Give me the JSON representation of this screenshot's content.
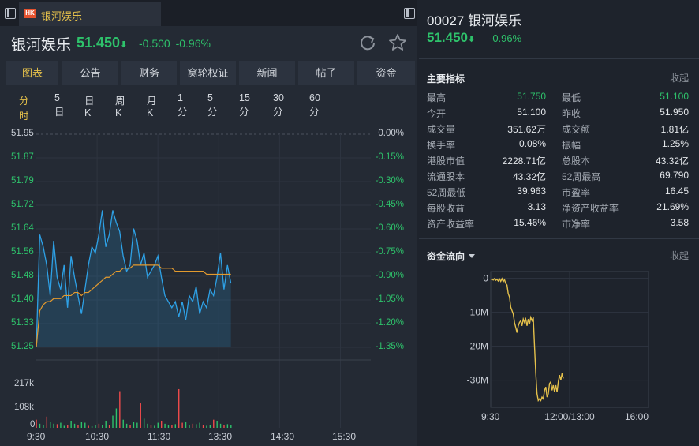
{
  "tab": {
    "badge": "HK",
    "title": "银河娱乐"
  },
  "quote": {
    "name": "银河娱乐",
    "price": "51.450",
    "change": "-0.500",
    "change_pct": "-0.96%"
  },
  "nav": [
    "图表",
    "公告",
    "财务",
    "窝轮权证",
    "新闻",
    "帖子",
    "资金"
  ],
  "periods": [
    "分时",
    "5日",
    "日K",
    "周K",
    "月K",
    "1分",
    "5分",
    "15分",
    "30分",
    "60分"
  ],
  "chart": {
    "price_ticks": [
      "51.95",
      "51.87",
      "51.79",
      "51.72",
      "51.64",
      "51.56",
      "51.48",
      "51.40",
      "51.33",
      "51.25"
    ],
    "pct_ticks": [
      "0.00%",
      "-0.15%",
      "-0.30%",
      "-0.45%",
      "-0.60%",
      "-0.75%",
      "-0.90%",
      "-1.05%",
      "-1.20%",
      "-1.35%"
    ],
    "volume_ticks": [
      "217k",
      "108k",
      "0"
    ],
    "time_ticks": [
      "9:30",
      "10:30",
      "11:30",
      "13:30",
      "14:30",
      "15:30"
    ]
  },
  "chart_data": [
    {
      "type": "line",
      "series": [
        {
          "values": [
            51.25,
            51.62,
            51.58,
            51.52,
            51.42,
            51.6,
            51.48,
            51.44,
            51.52,
            51.38,
            51.55,
            51.48,
            51.42,
            51.36,
            51.44,
            51.52,
            51.58,
            51.56,
            51.62,
            51.7,
            51.58,
            51.62,
            51.7,
            51.66,
            51.63,
            51.55,
            51.5,
            51.52,
            51.64,
            51.6,
            51.52,
            51.56,
            51.48,
            51.5,
            51.52,
            51.55,
            51.48,
            51.42,
            51.4,
            51.38,
            51.4,
            51.35,
            51.4,
            51.34,
            51.42,
            51.4,
            51.45,
            51.36,
            51.4,
            51.38,
            51.44,
            51.42,
            51.48,
            51.56,
            51.44,
            51.52,
            51.46
          ]
        },
        {
          "values": [
            51.25,
            51.37,
            51.39,
            51.4,
            51.4,
            51.41,
            51.41,
            51.41,
            51.42,
            51.42,
            51.42,
            51.43,
            51.43,
            51.42,
            51.43,
            51.43,
            51.44,
            51.45,
            51.46,
            51.47,
            51.48,
            51.48,
            51.49,
            51.5,
            51.5,
            51.51,
            51.51,
            51.51,
            51.52,
            51.52,
            51.52,
            51.52,
            51.52,
            51.52,
            51.52,
            51.52,
            51.51,
            51.51,
            51.51,
            51.51,
            51.5,
            51.5,
            51.5,
            51.5,
            51.5,
            51.5,
            51.5,
            51.5,
            51.5,
            51.49,
            51.49,
            51.49,
            51.49,
            51.49,
            51.49,
            51.49,
            51.49
          ]
        }
      ],
      "ylim": [
        51.25,
        51.95
      ],
      "x_range": [
        "9:30",
        "16:00"
      ]
    },
    {
      "type": "bar",
      "values": [
        40,
        20,
        15,
        55,
        30,
        20,
        18,
        25,
        10,
        15,
        35,
        20,
        12,
        30,
        25,
        10,
        8,
        15,
        20,
        12,
        35,
        15,
        60,
        95,
        180,
        40,
        20,
        15,
        30,
        25,
        120,
        45,
        20,
        15,
        10,
        25,
        35,
        20,
        15,
        12,
        18,
        190,
        25,
        30,
        15,
        20,
        18,
        25,
        12,
        10,
        15,
        40,
        35,
        20,
        15,
        18,
        12
      ],
      "volume_ticks_k": [
        0,
        108,
        217
      ]
    },
    {
      "type": "line",
      "title": "资金流向",
      "series": [
        {
          "values": [
            -0.3,
            -0.2,
            -0.5,
            -0.1,
            -0.6,
            -0.3,
            -0.8,
            -0.2,
            -0.9,
            -0.1,
            -1.0,
            -0.4,
            -1.5,
            -2.0,
            -4.5,
            -5.5,
            -8.5,
            -9.5,
            -10.5,
            -13.0,
            -14.5,
            -16.0,
            -14.0,
            -13.0,
            -12.5,
            -14.0,
            -12.0,
            -13.0,
            -12.0,
            -14.0,
            -12.0,
            -13.5,
            -11.5,
            -12.5,
            -11.5,
            -20.0,
            -28.0,
            -34.0,
            -36.0,
            -35.5,
            -36.0,
            -35.0,
            -35.5,
            -33.0,
            -32.0,
            -35.0,
            -34.0,
            -31.0,
            -30.5,
            -33.0,
            -31.5,
            -33.5,
            -31.5,
            -33.5,
            -30.5,
            -28.5,
            -30.0,
            -28.0,
            -29.5
          ]
        }
      ],
      "ylim": [
        -38,
        2
      ],
      "y_ticks": [
        "0",
        "-10M",
        "-20M",
        "-30M"
      ],
      "x_ticks": [
        "9:30",
        "12:00/13:00",
        "16:00"
      ]
    }
  ],
  "right": {
    "title": "00027 银河娱乐",
    "price": "51.450",
    "change_pct": "-0.96%",
    "metrics_title": "主要指标",
    "collapse_label": "收起",
    "metrics": [
      [
        "最高",
        "51.750",
        "最低",
        "51.100"
      ],
      [
        "今开",
        "51.100",
        "昨收",
        "51.950"
      ],
      [
        "成交量",
        "351.62万",
        "成交额",
        "1.81亿"
      ],
      [
        "换手率",
        "0.08%",
        "振幅",
        "1.25%"
      ],
      [
        "港股市值",
        "2228.71亿",
        "总股本",
        "43.32亿"
      ],
      [
        "流通股本",
        "43.32亿",
        "52周最高",
        "69.790"
      ],
      [
        "52周最低",
        "39.963",
        "市盈率",
        "16.45"
      ],
      [
        "每股收益",
        "3.13",
        "净资产收益率",
        "21.69%"
      ],
      [
        "资产收益率",
        "15.46%",
        "市净率",
        "3.58"
      ]
    ],
    "flow_title": "资金流向",
    "flow_collapse_label": "收起",
    "colors": {
      "up": "#ef4b4b",
      "down": "#2ec26b",
      "accent": "#e4c04b",
      "price_line": "#2ea1e6",
      "avg_line": "#e39a2e"
    }
  }
}
